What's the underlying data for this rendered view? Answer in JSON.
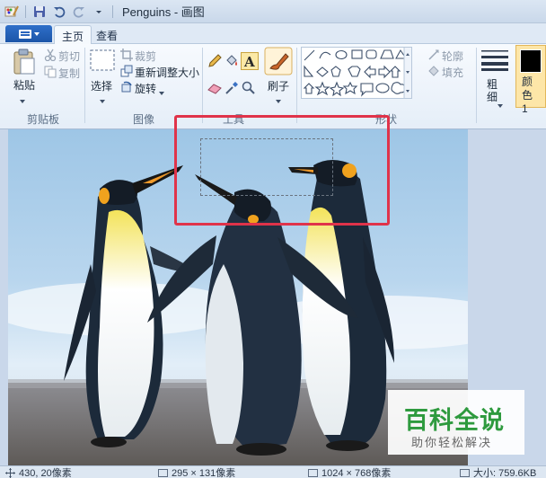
{
  "window": {
    "title": "Penguins - 画图"
  },
  "tabs": [
    "主页",
    "查看"
  ],
  "ribbon": {
    "clipboard": {
      "paste": "粘贴",
      "cut": "剪切",
      "copy": "复制",
      "label": "剪贴板"
    },
    "image": {
      "select": "选择",
      "crop": "裁剪",
      "resize": "重新调整大小",
      "rotate": "旋转",
      "label": "图像"
    },
    "tools": {
      "label": "工具"
    },
    "brushes": {
      "label": "刷子"
    },
    "shapes": {
      "outline": "轮廓",
      "fill": "填充",
      "label": "形状"
    },
    "size": {
      "label": "粗细"
    },
    "color1": {
      "label": "颜色 1"
    }
  },
  "watermark": {
    "title": "百科全说",
    "subtitle": "助你轻松解决"
  },
  "status": {
    "cursor": "430, 20像素",
    "selection": "295 × 131像素",
    "image_size": "1024 × 768像素",
    "file_size": "大小: 759.6KB"
  },
  "colors": {
    "accent": "#1b55a8",
    "annotation": "#e0334a",
    "watermark_green": "#2e9a3e"
  }
}
